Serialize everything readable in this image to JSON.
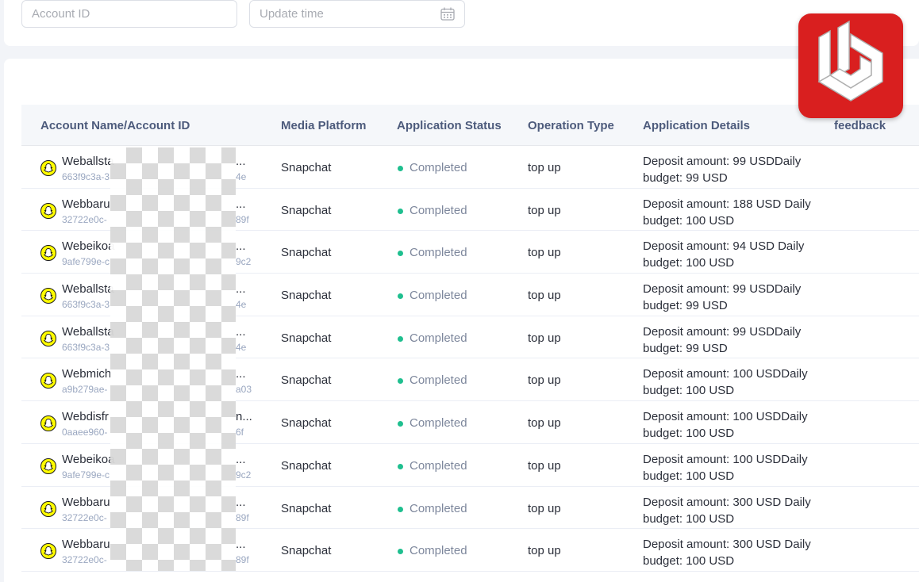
{
  "filters": {
    "account_id_placeholder": "Account ID",
    "update_time_placeholder": "Update time"
  },
  "table": {
    "columns": {
      "account": "Account Name/Account ID",
      "platform": "Media Platform",
      "status": "Application Status",
      "operation": "Operation Type",
      "details": "Application Details",
      "feedback": "feedback"
    },
    "rows": [
      {
        "name": "Weballsta",
        "name_end": "...",
        "id": "663f9c3a-3",
        "id_end": "4e",
        "platform": "Snapchat",
        "status": "Completed",
        "operation": "top up",
        "details": "Deposit amount: 99 USDDaily budget: 99 USD"
      },
      {
        "name": "Webbaru",
        "name_end": "...",
        "id": "32722e0c-",
        "id_end": "89f",
        "platform": "Snapchat",
        "status": "Completed",
        "operation": "top up",
        "details": "Deposit amount: 188 USD Daily budget: 100 USD"
      },
      {
        "name": "Webeikoa",
        "name_end": "...",
        "id": "9afe799e-c",
        "id_end": "9c2",
        "platform": "Snapchat",
        "status": "Completed",
        "operation": "top up",
        "details": "Deposit amount: 94 USD Daily budget: 100 USD"
      },
      {
        "name": "Weballsta",
        "name_end": "...",
        "id": "663f9c3a-3",
        "id_end": "4e",
        "platform": "Snapchat",
        "status": "Completed",
        "operation": "top up",
        "details": "Deposit amount: 99 USDDaily budget: 99 USD"
      },
      {
        "name": "Weballsta",
        "name_end": "...",
        "id": "663f9c3a-3",
        "id_end": "4e",
        "platform": "Snapchat",
        "status": "Completed",
        "operation": "top up",
        "details": "Deposit amount: 99 USDDaily budget: 99 USD"
      },
      {
        "name": "Webmich",
        "name_end": "...",
        "id": "a9b279ae-",
        "id_end": "a03",
        "platform": "Snapchat",
        "status": "Completed",
        "operation": "top up",
        "details": "Deposit amount: 100 USDDaily budget: 100 USD"
      },
      {
        "name": "Webdisfr",
        "name_end": "n...",
        "id": "0aaee960-",
        "id_end": "6f",
        "platform": "Snapchat",
        "status": "Completed",
        "operation": "top up",
        "details": "Deposit amount: 100 USDDaily budget: 100 USD"
      },
      {
        "name": "Webeikoa",
        "name_end": "...",
        "id": "9afe799e-c",
        "id_end": "9c2",
        "platform": "Snapchat",
        "status": "Completed",
        "operation": "top up",
        "details": "Deposit amount: 100 USDDaily budget: 100 USD"
      },
      {
        "name": "Webbaru",
        "name_end": "...",
        "id": "32722e0c-",
        "id_end": "89f",
        "platform": "Snapchat",
        "status": "Completed",
        "operation": "top up",
        "details": "Deposit amount: 300 USD Daily budget: 100 USD"
      },
      {
        "name": "Webbaru",
        "name_end": "...",
        "id": "32722e0c-",
        "id_end": "89f",
        "platform": "Snapchat",
        "status": "Completed",
        "operation": "top up",
        "details": "Deposit amount: 300 USD Daily budget: 100 USD"
      }
    ]
  },
  "icons": {
    "calendar": "calendar-icon",
    "platform": "snapchat-icon",
    "status": "status-dot-green",
    "brand": "brand-logo"
  },
  "colors": {
    "status_completed": "#1fbf8f",
    "snapchat_yellow": "#fffc00",
    "logo_red": "#d91f1f",
    "header_text": "#4d5b7c"
  }
}
